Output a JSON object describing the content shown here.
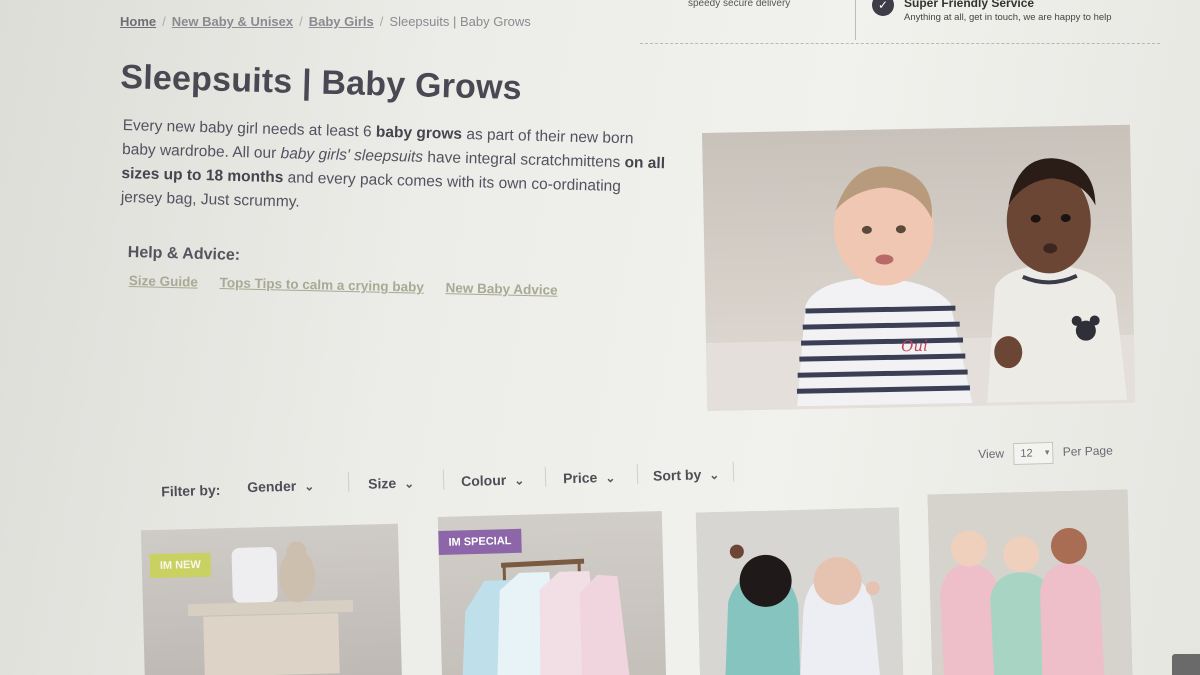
{
  "service_strip": {
    "delivery_text": "speedy secure delivery",
    "service_title": "Super Friendly Service",
    "service_subtitle": "Anything at all, get in touch, we are happy to help",
    "service_icon": "check-icon"
  },
  "breadcrumb": {
    "items": [
      "Home",
      "New Baby & Unisex",
      "Baby Girls"
    ],
    "current": "Sleepsuits | Baby Grows"
  },
  "page_title": "Sleepsuits | Baby Grows",
  "intro": {
    "p1": "Every new baby girl needs at least 6 ",
    "b1": "baby grows",
    "p2": " as part of their new born baby wardrobe. All our ",
    "i1": "baby girls' sleepsuits",
    "p3": " have integral scratchmittens ",
    "b2": "on all sizes up to 18 months",
    "p4": " and every pack comes with its own co-ordinating jersey bag, Just scrummy."
  },
  "help": {
    "title": "Help & Advice:",
    "links": [
      "Size Guide",
      "Tops Tips to calm a crying baby",
      "New Baby Advice"
    ]
  },
  "filters": {
    "label": "Filter by:",
    "items": [
      "Gender",
      "Size",
      "Colour",
      "Price",
      "Sort by"
    ]
  },
  "view": {
    "label": "View",
    "value": "12",
    "suffix": "Per Page"
  },
  "products": [
    {
      "badge": "IM NEW"
    },
    {
      "badge": "IM SPECIAL"
    },
    {
      "badge": ""
    },
    {
      "badge": ""
    }
  ],
  "colors": {
    "badge_new": "#c9d162",
    "badge_special": "#8d66a9",
    "link": "#a9a995",
    "text": "#4a4852"
  }
}
